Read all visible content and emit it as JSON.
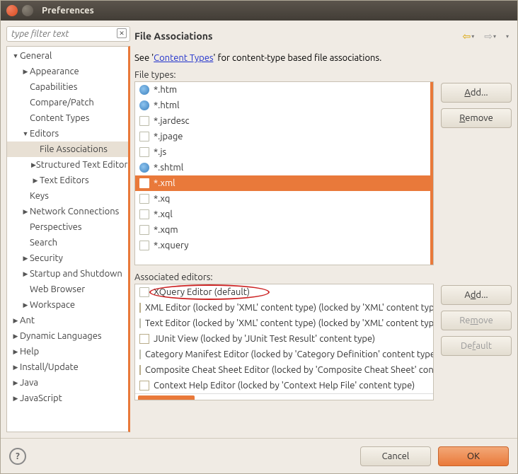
{
  "window": {
    "title": "Preferences"
  },
  "filter": {
    "placeholder": "type filter text"
  },
  "tree": [
    {
      "label": "General",
      "depth": 1,
      "arrow": "▼"
    },
    {
      "label": "Appearance",
      "depth": 2,
      "arrow": "▶"
    },
    {
      "label": "Capabilities",
      "depth": 2,
      "arrow": ""
    },
    {
      "label": "Compare/Patch",
      "depth": 2,
      "arrow": ""
    },
    {
      "label": "Content Types",
      "depth": 2,
      "arrow": ""
    },
    {
      "label": "Editors",
      "depth": 2,
      "arrow": "▼"
    },
    {
      "label": "File Associations",
      "depth": 3,
      "arrow": "",
      "selected": true
    },
    {
      "label": "Structured Text Editors",
      "depth": 3,
      "arrow": "▶"
    },
    {
      "label": "Text Editors",
      "depth": 3,
      "arrow": "▶"
    },
    {
      "label": "Keys",
      "depth": 2,
      "arrow": ""
    },
    {
      "label": "Network Connections",
      "depth": 2,
      "arrow": "▶"
    },
    {
      "label": "Perspectives",
      "depth": 2,
      "arrow": ""
    },
    {
      "label": "Search",
      "depth": 2,
      "arrow": ""
    },
    {
      "label": "Security",
      "depth": 2,
      "arrow": "▶"
    },
    {
      "label": "Startup and Shutdown",
      "depth": 2,
      "arrow": "▶"
    },
    {
      "label": "Web Browser",
      "depth": 2,
      "arrow": ""
    },
    {
      "label": "Workspace",
      "depth": 2,
      "arrow": "▶"
    },
    {
      "label": "Ant",
      "depth": 1,
      "arrow": "▶"
    },
    {
      "label": "Dynamic Languages",
      "depth": 1,
      "arrow": "▶"
    },
    {
      "label": "Help",
      "depth": 1,
      "arrow": "▶"
    },
    {
      "label": "Install/Update",
      "depth": 1,
      "arrow": "▶"
    },
    {
      "label": "Java",
      "depth": 1,
      "arrow": "▶"
    },
    {
      "label": "JavaScript",
      "depth": 1,
      "arrow": "▶"
    }
  ],
  "page": {
    "title": "File Associations",
    "see_prefix": "See '",
    "content_types_link": "Content Types",
    "see_suffix": "' for content-type based file associations.",
    "file_types_label": "File types:",
    "associated_editors_label": "Associated editors:"
  },
  "file_types": [
    {
      "icon": "globe",
      "label": "*.htm"
    },
    {
      "icon": "globe",
      "label": "*.html"
    },
    {
      "icon": "file",
      "label": "*.jardesc"
    },
    {
      "icon": "file",
      "label": "*.jpage"
    },
    {
      "icon": "file",
      "label": "*.js"
    },
    {
      "icon": "globe",
      "label": "*.shtml"
    },
    {
      "icon": "file",
      "label": "*.xml",
      "selected": true
    },
    {
      "icon": "file",
      "label": "*.xq"
    },
    {
      "icon": "file",
      "label": "*.xql"
    },
    {
      "icon": "file",
      "label": "*.xqm"
    },
    {
      "icon": "file",
      "label": "*.xquery"
    }
  ],
  "ft_buttons": {
    "add": "Add...",
    "remove": "Remove"
  },
  "editors": [
    {
      "icon": "file",
      "label": "XQuery Editor (default)",
      "circled": true
    },
    {
      "icon": "mark",
      "label": "XML Editor (locked by 'XML' content type) (locked by 'XML' content type)"
    },
    {
      "icon": "file",
      "label": "Text Editor (locked by 'XML' content type) (locked by 'XML' content type)"
    },
    {
      "icon": "mark",
      "label": "JUnit View (locked by 'JUnit Test Result' content type)"
    },
    {
      "icon": "file",
      "label": "Category Manifest Editor (locked by 'Category Definition' content type)"
    },
    {
      "icon": "mark",
      "label": "Composite Cheat Sheet Editor (locked by 'Composite Cheat Sheet' content type)"
    },
    {
      "icon": "mark",
      "label": "Context Help Editor (locked by 'Context Help File' content type)"
    }
  ],
  "ed_buttons": {
    "add": "Add...",
    "remove": "Remove",
    "default": "Default"
  },
  "footer": {
    "cancel": "Cancel",
    "ok": "OK"
  }
}
